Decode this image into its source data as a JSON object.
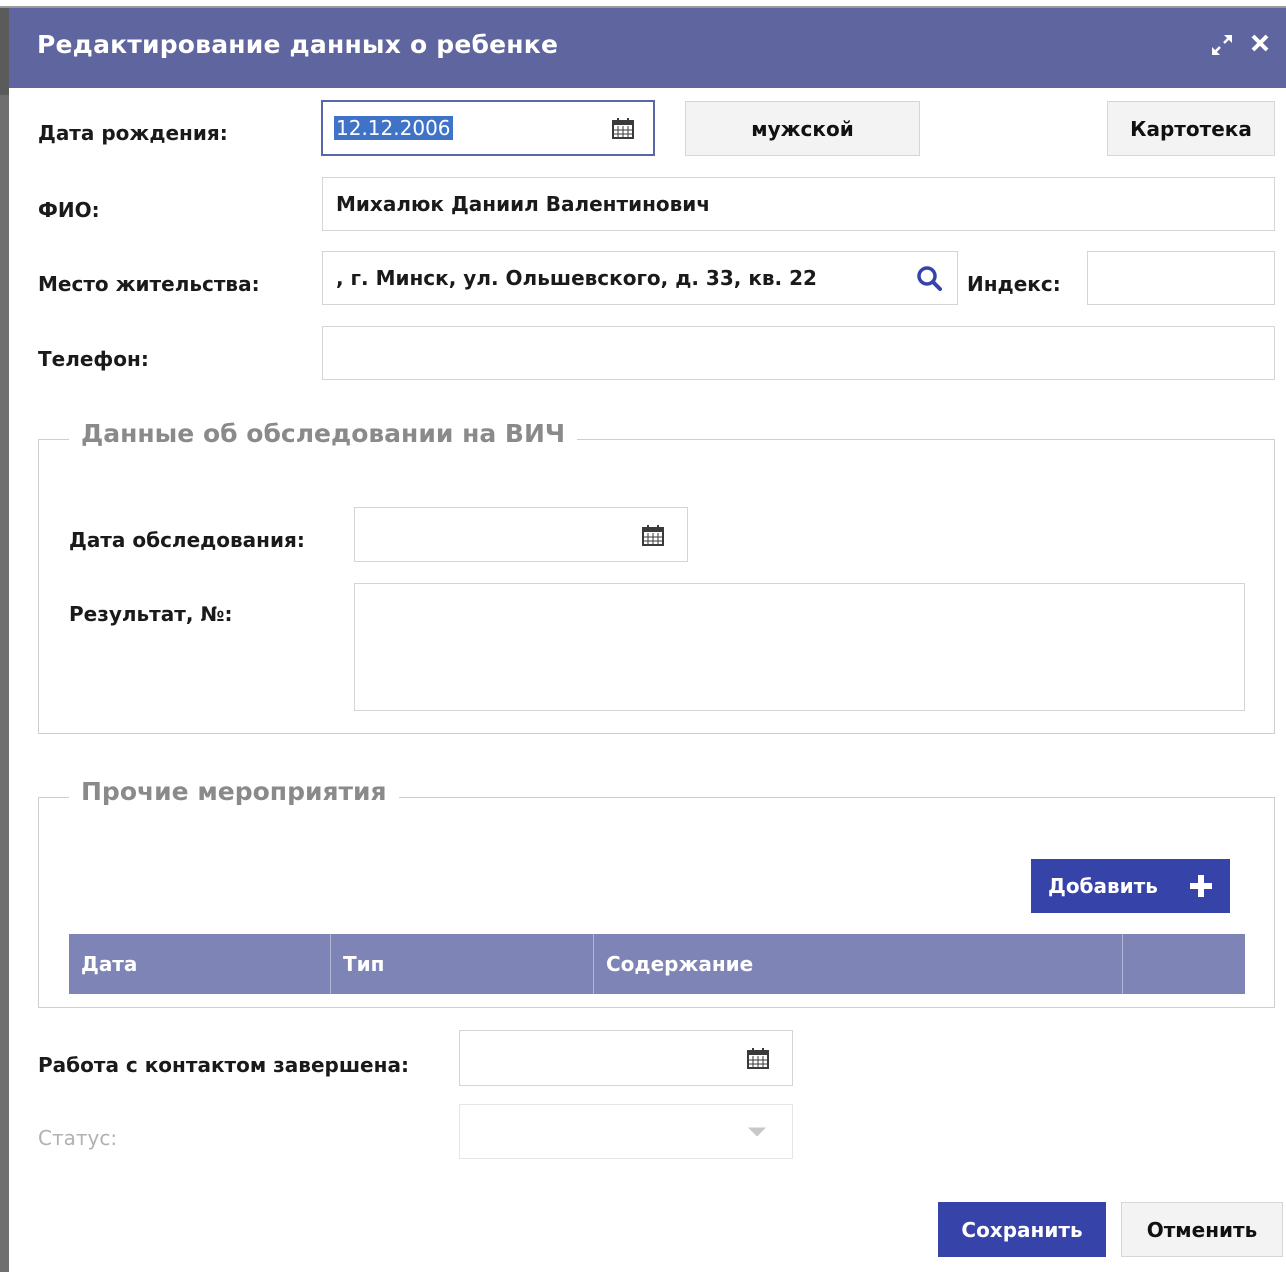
{
  "window": {
    "title": "Редактирование данных о ребенке",
    "maximize_icon": "maximize-icon",
    "close_icon": "close-icon"
  },
  "fields": {
    "birth_date_label": "Дата рождения:",
    "birth_date_value": "12.12.2006",
    "gender_button": "мужской",
    "card_button": "Картотека",
    "fio_label": "ФИО:",
    "fio_value": "Михалюк Даниил Валентинович",
    "address_label": "Место жительства:",
    "address_value": ", г. Минск, ул. Ольшевского, д. 33, кв. 22",
    "index_label": "Индекс:",
    "index_value": "",
    "phone_label": "Телефон:",
    "phone_value": ""
  },
  "hiv_section": {
    "legend": "Данные об обследовании на ВИЧ",
    "exam_date_label": "Дата обследования:",
    "exam_date_value": "",
    "result_label": "Результат, №:",
    "result_value": ""
  },
  "other_section": {
    "legend": "Прочие мероприятия",
    "add_button": "Добавить",
    "columns": [
      "Дата",
      "Тип",
      "Содержание",
      ""
    ]
  },
  "footer_fields": {
    "contact_done_label": "Работа с контактом завершена:",
    "contact_done_value": "",
    "status_label": "Статус:",
    "status_value": ""
  },
  "actions": {
    "save": "Сохранить",
    "cancel": "Отменить"
  },
  "colors": {
    "titlebar": "#5f659f",
    "primary": "#3643a8",
    "grid_header": "#7f84b6",
    "selection": "#3f73c8"
  }
}
